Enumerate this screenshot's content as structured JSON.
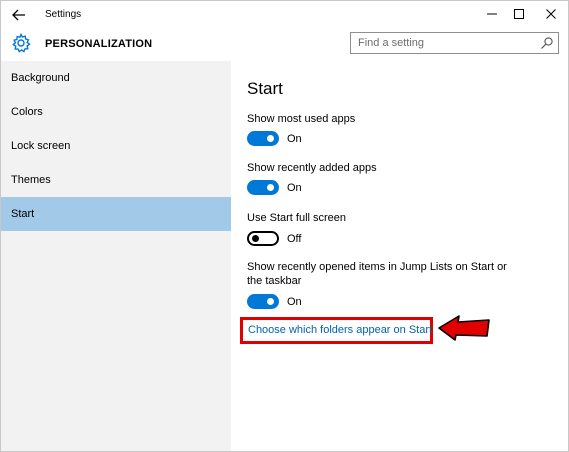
{
  "window": {
    "title": "Settings"
  },
  "header": {
    "section": "PERSONALIZATION",
    "search_placeholder": "Find a setting"
  },
  "sidebar": {
    "items": [
      {
        "label": "Background"
      },
      {
        "label": "Colors"
      },
      {
        "label": "Lock screen"
      },
      {
        "label": "Themes"
      },
      {
        "label": "Start",
        "active": true
      }
    ]
  },
  "content": {
    "heading": "Start",
    "settings": [
      {
        "label": "Show most used apps",
        "state": "On"
      },
      {
        "label": "Show recently added apps",
        "state": "On"
      },
      {
        "label": "Use Start full screen",
        "state": "Off"
      },
      {
        "label": "Show recently opened items in Jump Lists on Start or the taskbar",
        "state": "On"
      }
    ],
    "link": "Choose which folders appear on Start"
  },
  "colors": {
    "accent": "#0078d7",
    "sidebar_active": "#a2c9e8",
    "highlight_box": "#e00000",
    "link": "#0063b1"
  },
  "icons": [
    "back-arrow-icon",
    "minimize-icon",
    "maximize-icon",
    "close-icon",
    "gear-icon",
    "search-icon",
    "red-arrow-icon"
  ]
}
